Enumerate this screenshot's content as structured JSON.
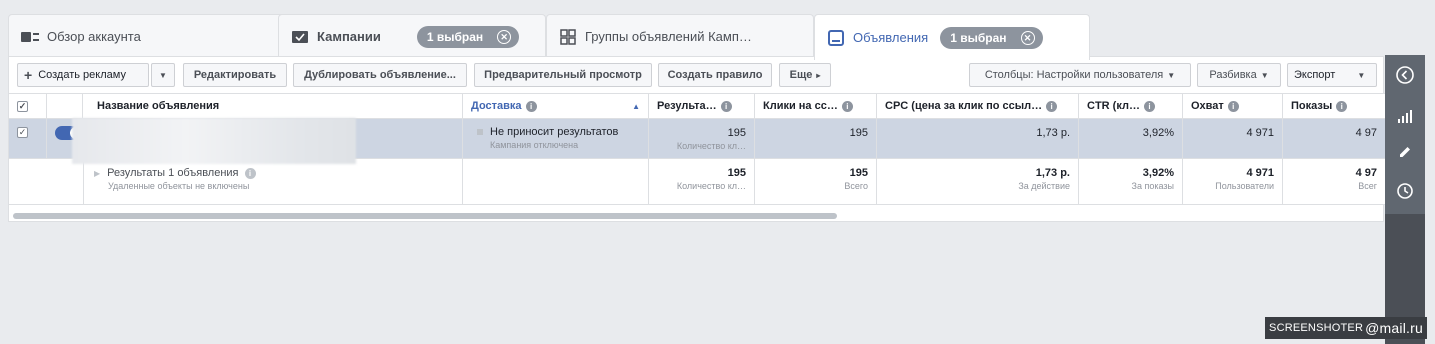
{
  "tabs": [
    {
      "label": "Обзор аккаунта",
      "icon": "account-overview-icon"
    },
    {
      "label": "Кампании",
      "icon": "campaign-folder-icon",
      "pill": "1 выбран"
    },
    {
      "label": "Группы объявлений Камп…",
      "icon": "ad-sets-grid-icon"
    },
    {
      "label": "Объявления",
      "icon": "ads-icon",
      "pill": "1 выбран",
      "active": true
    }
  ],
  "toolbar": {
    "create": "Создать рекламу",
    "edit": "Редактировать",
    "duplicate": "Дублировать объявление...",
    "preview": "Предварительный просмотр",
    "create_rule": "Создать правило",
    "more": "Еще",
    "columns": "Столбцы: Настройки пользователя",
    "breakdown": "Разбивка",
    "export": "Экспорт"
  },
  "columns": {
    "name": "Название объявления",
    "delivery": "Доставка",
    "results": "Результа…",
    "clicks": "Клики на сс…",
    "cpc": "CPC (цена за клик по ссыл…",
    "ctr": "CTR (кл…",
    "reach": "Охват",
    "impressions": "Показы"
  },
  "ad_row": {
    "delivery_status": "Не приносит результатов",
    "delivery_sub": "Кампания отключена",
    "results": "195",
    "results_sub": "Количество кл…",
    "clicks": "195",
    "cpc": "1,73 р.",
    "ctr": "3,92%",
    "reach": "4 971",
    "impressions": "4 97"
  },
  "summary_row": {
    "title": "Результаты 1 объявления",
    "subtitle": "Удаленные объекты не включены",
    "results": "195",
    "results_sub": "Количество кл…",
    "clicks": "195",
    "clicks_sub": "Всего",
    "cpc": "1,73 р.",
    "cpc_sub": "За действие",
    "ctr": "3,92%",
    "ctr_sub": "За показы",
    "reach": "4 971",
    "reach_sub": "Пользователи",
    "impressions": "4 97",
    "impressions_sub": "Всег"
  },
  "watermark": {
    "left": "SCREENSHOTER",
    "right": "@mail.ru"
  },
  "colors": {
    "accent": "#4267b2",
    "selected_row": "#cdd5e2",
    "sidebar": "#4b4f56"
  }
}
